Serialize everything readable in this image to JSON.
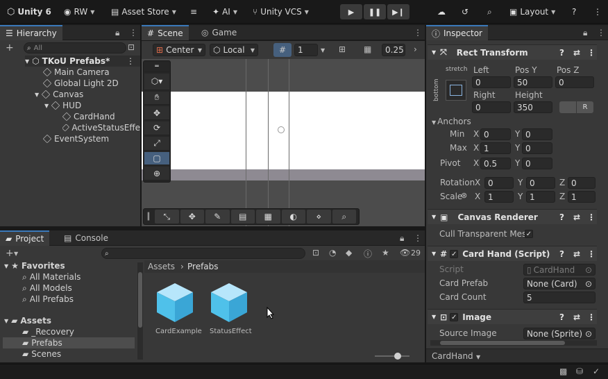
{
  "topbar": {
    "product": "Unity 6",
    "account": "RW",
    "asset_store": "Asset Store",
    "ai": "AI",
    "vcs": "Unity VCS",
    "layout": "Layout"
  },
  "hierarchy": {
    "tab": "Hierarchy",
    "search_placeholder": "All",
    "root": "TKoU Prefabs*",
    "items": [
      {
        "label": "Main Camera"
      },
      {
        "label": "Global Light 2D"
      },
      {
        "label": "Canvas"
      },
      {
        "label": "HUD"
      },
      {
        "label": "CardHand"
      },
      {
        "label": "ActiveStatusEffe"
      },
      {
        "label": "EventSystem"
      }
    ]
  },
  "scene": {
    "tab_scene": "Scene",
    "tab_game": "Game",
    "pivot_mode": "Center",
    "space_mode": "Local",
    "grid_value": "1",
    "snap_value": "0.25"
  },
  "project": {
    "tab_project": "Project",
    "tab_console": "Console",
    "hidden_count": "29",
    "favorites": "Favorites",
    "fav_items": [
      "All Materials",
      "All Models",
      "All Prefabs"
    ],
    "assets": "Assets",
    "asset_folders": [
      "_Recovery",
      "Prefabs",
      "Scenes"
    ],
    "breadcrumb_root": "Assets",
    "breadcrumb_current": "Prefabs",
    "files": [
      {
        "name": "CardExample"
      },
      {
        "name": "StatusEffect"
      }
    ]
  },
  "inspector": {
    "tab": "Inspector",
    "rect_transform": {
      "title": "Rect Transform",
      "anchor_h": "stretch",
      "anchor_v": "bottom",
      "left_label": "Left",
      "left": "0",
      "posy_label": "Pos Y",
      "posy": "50",
      "posz_label": "Pos Z",
      "posz": "0",
      "right_label": "Right",
      "right": "0",
      "height_label": "Height",
      "height": "350",
      "anchors_label": "Anchors",
      "min_label": "Min",
      "min_x": "0",
      "min_y": "0",
      "max_label": "Max",
      "max_x": "1",
      "max_y": "0",
      "pivot_label": "Pivot",
      "pivot_x": "0.5",
      "pivot_y": "0",
      "rotation_label": "Rotation",
      "rot_x": "0",
      "rot_y": "0",
      "rot_z": "0",
      "scale_label": "Scale",
      "scale_x": "1",
      "scale_y": "1",
      "scale_z": "1",
      "axis_x": "X",
      "axis_y": "Y",
      "axis_z": "Z"
    },
    "canvas_renderer": {
      "title": "Canvas Renderer",
      "cull_label": "Cull Transparent Mes"
    },
    "card_hand": {
      "title": "Card Hand (Script)",
      "script_label": "Script",
      "script_value": "CardHand",
      "prefab_label": "Card Prefab",
      "prefab_value": "None (Card)",
      "count_label": "Card Count",
      "count_value": "5"
    },
    "image": {
      "title": "Image",
      "source_label": "Source Image",
      "source_value": "None (Sprite)"
    },
    "footer": "CardHand"
  }
}
